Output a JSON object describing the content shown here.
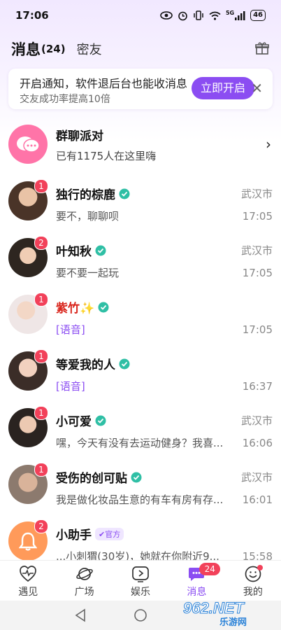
{
  "status": {
    "time": "17:06",
    "network": "5G",
    "battery": "46"
  },
  "header": {
    "tab_messages": "消息",
    "tab_count": "(24)",
    "tab_friends": "密友"
  },
  "notice": {
    "title": "开启通知，软件退后台也能收消息",
    "subtitle": "交友成功率提高10倍",
    "button": "立即开启",
    "close": "✕"
  },
  "group": {
    "name": "群聊派对",
    "subtitle": "已有1175人在这里嗨"
  },
  "conversations": [
    {
      "name": "独行的棕鹿",
      "badge": "1",
      "location": "武汉市",
      "preview": "要不，聊聊呗",
      "time": "17:05",
      "voice": false
    },
    {
      "name": "叶知秋",
      "badge": "2",
      "location": "武汉市",
      "preview": "要不要一起玩",
      "time": "17:05",
      "voice": false
    },
    {
      "name": "紫竹✨",
      "badge": "1",
      "location": "",
      "preview": "[语音]",
      "time": "17:05",
      "voice": true
    },
    {
      "name": "等爱我的人",
      "badge": "1",
      "location": "",
      "preview": "[语音]",
      "time": "16:37",
      "voice": true
    },
    {
      "name": "小可爱",
      "badge": "1",
      "location": "武汉市",
      "preview": "嘿，今天有没有去运动健身？我喜...",
      "time": "16:06",
      "voice": false
    },
    {
      "name": "受伤的创可贴",
      "badge": "1",
      "location": "武汉市",
      "preview": "我是做化妆品生意的有车有房有存...",
      "time": "16:01",
      "voice": false
    },
    {
      "name": "小助手",
      "badge": "2",
      "official": "官方",
      "location": "",
      "preview": "...小刺猬(30岁)，她就在你附近9...",
      "time": "15:58",
      "voice": false
    }
  ],
  "bottom_nav": [
    {
      "label": "遇见",
      "icon": "heartbeat-icon"
    },
    {
      "label": "广场",
      "icon": "planet-icon"
    },
    {
      "label": "娱乐",
      "icon": "play-icon"
    },
    {
      "label": "消息",
      "icon": "chat-icon",
      "badge": "24",
      "active": true
    },
    {
      "label": "我的",
      "icon": "face-icon"
    }
  ],
  "watermark": {
    "text": "962.NET",
    "sub": "乐游网"
  },
  "colors": {
    "accent": "#8b4df2",
    "badge": "#f2415a",
    "verified": "#2fbfa5",
    "group_avatar": "#ff74a8"
  }
}
